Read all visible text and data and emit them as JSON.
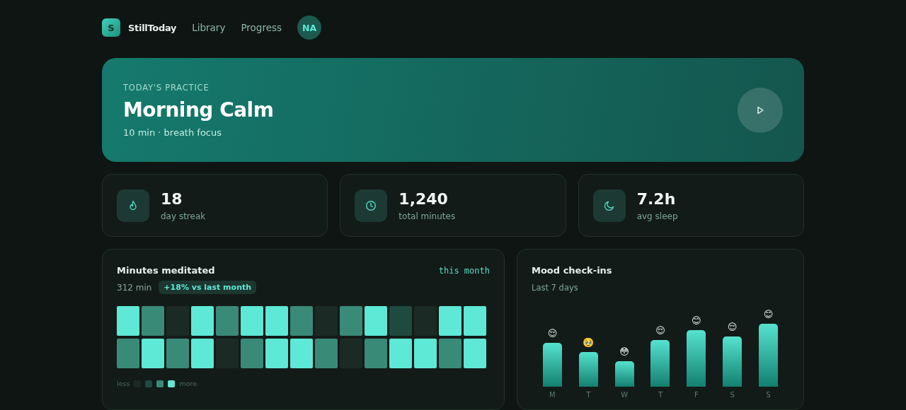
{
  "nav": {
    "logo_letter": "S",
    "brand": "StillToday",
    "links": [
      "Library",
      "Progress"
    ],
    "avatar": "NA"
  },
  "hero": {
    "eyebrow": "TODAY'S PRACTICE",
    "title": "Morning Calm",
    "subtitle": "10 min · breath focus"
  },
  "stats": [
    {
      "kind": "flame",
      "value": "18",
      "label": "day streak"
    },
    {
      "kind": "clock",
      "value": "1,240",
      "label": "total minutes"
    },
    {
      "kind": "moon",
      "value": "7.2h",
      "label": "avg sleep"
    }
  ],
  "minutes": {
    "title": "Minutes meditated",
    "period": "this month",
    "total": "312 min",
    "badge": "+18% vs last month",
    "rows": [
      [
        {
          "kind": "high"
        },
        {
          "kind": "mid"
        },
        {
          "kind": "none"
        },
        {
          "kind": "high"
        },
        {
          "kind": "mid"
        },
        {
          "kind": "high"
        },
        {
          "kind": "high"
        },
        {
          "kind": "mid"
        },
        {
          "kind": "none"
        },
        {
          "kind": "mid"
        },
        {
          "kind": "high"
        },
        {
          "kind": "low"
        },
        {
          "kind": "none"
        },
        {
          "kind": "high"
        },
        {
          "kind": "high"
        }
      ],
      [
        {
          "kind": "mid"
        },
        {
          "kind": "high"
        },
        {
          "kind": "mid"
        },
        {
          "kind": "high"
        },
        {
          "kind": "none"
        },
        {
          "kind": "mid"
        },
        {
          "kind": "high"
        },
        {
          "kind": "high"
        },
        {
          "kind": "mid"
        },
        {
          "kind": "none"
        },
        {
          "kind": "mid"
        },
        {
          "kind": "high"
        },
        {
          "kind": "high"
        },
        {
          "kind": "mid"
        },
        {
          "kind": "high"
        }
      ]
    ],
    "legend_less": "less",
    "legend_more": "more"
  },
  "mood": {
    "title": "Mood check-ins",
    "subtitle": "Last 7 days",
    "days": [
      {
        "day": "M",
        "emoji": "😌"
      },
      {
        "day": "T",
        "emoji": "🥹"
      },
      {
        "day": "W",
        "emoji": "😳"
      },
      {
        "day": "T",
        "emoji": "😌"
      },
      {
        "day": "F",
        "emoji": "😊"
      },
      {
        "day": "S",
        "emoji": "😌"
      },
      {
        "day": "S",
        "emoji": "😊"
      }
    ]
  }
}
